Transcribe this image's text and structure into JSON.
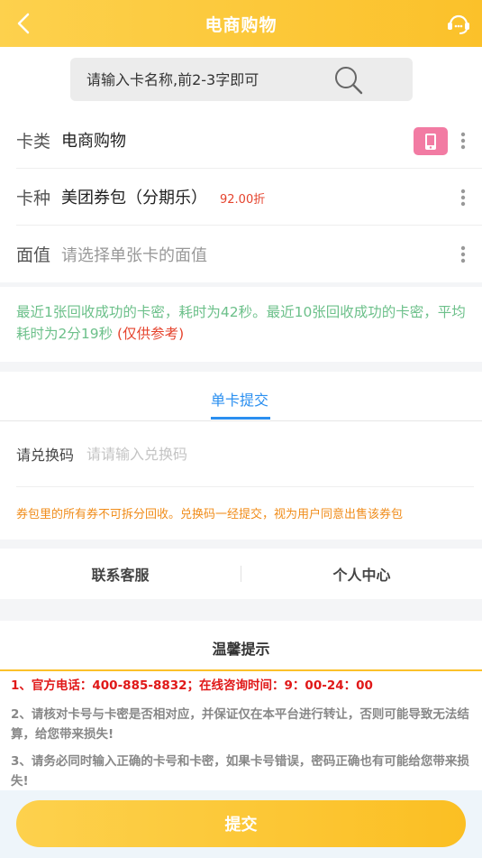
{
  "header": {
    "title": "电商购物",
    "back_icon": "back-arrow-icon",
    "service_icon": "customer-service-icon"
  },
  "search": {
    "placeholder": "请输入卡名称,前2-3字即可",
    "icon": "search-icon"
  },
  "form": {
    "card_type": {
      "label": "卡类",
      "value": "电商购物",
      "badge_icon": "phone-card-icon"
    },
    "card_kind": {
      "label": "卡种",
      "value": "美团券包（分期乐）",
      "discount": "92.00折"
    },
    "face_value": {
      "label": "面值",
      "placeholder": "请选择单张卡的面值"
    }
  },
  "notice": {
    "text": "最近1张回收成功的卡密，耗时为42秒。最近10张回收成功的卡密，平均耗时为2分19秒",
    "ref": " (仅供参考)"
  },
  "tabs": [
    {
      "label": "单卡提交",
      "active": true
    }
  ],
  "redeem": {
    "label": "请兑换码",
    "placeholder": "请请输入兑换码",
    "warning": "券包里的所有券不可拆分回收。兑换码一经提交，视为用户同意出售该券包"
  },
  "links": {
    "contact": "联系客服",
    "profile": "个人中心"
  },
  "tips": {
    "title": "温馨提示",
    "items": [
      "1、官方电话：400-885-8832；在线咨询时间：9：00-24：00",
      "2、请核对卡号与卡密是否相对应，并保证仅在本平台进行转让，否则可能导致无法结算，给您带来损失!",
      "3、请务必同时输入正确的卡号和卡密，如果卡号错误，密码正确也有可能给您带来损失!"
    ]
  },
  "submit": {
    "label": "提交"
  },
  "colors": {
    "primary": "#fbc12a",
    "accent_blue": "#2a8ff0",
    "danger": "#e01818",
    "success": "#6cc08a",
    "warn": "#f08c1a"
  }
}
